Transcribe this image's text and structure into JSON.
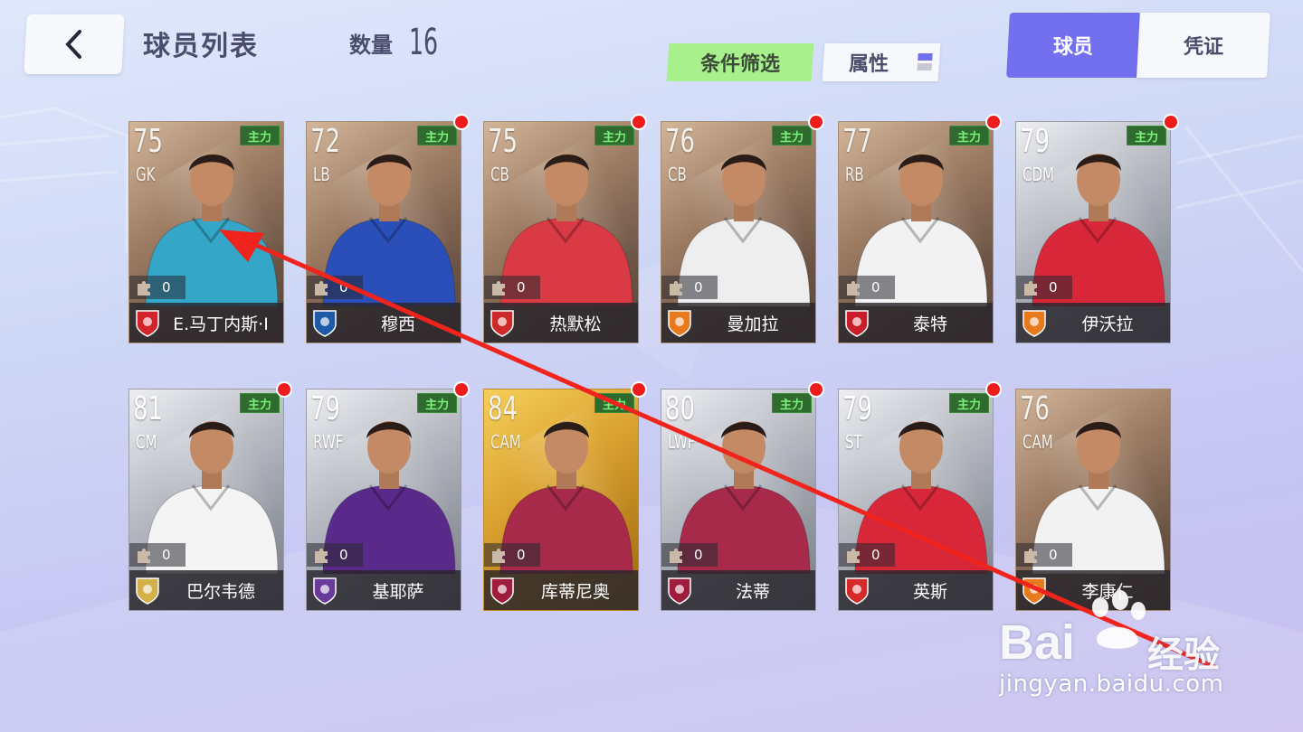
{
  "header": {
    "title": "球员列表",
    "count_label": "数量",
    "count_value": "16",
    "filter_label": "条件筛选",
    "attribute_label": "属性",
    "tabs": [
      {
        "label": "球员",
        "active": true
      },
      {
        "label": "凭证",
        "active": false
      }
    ]
  },
  "colors": {
    "accent": "#7370ef",
    "filter_bg": "#a8f08c",
    "badge_red": "#ee1c1c",
    "tag_green": "#2f6a2f",
    "annotation_arrow": "#f0241c"
  },
  "cards": [
    {
      "rating": "75",
      "position": "GK",
      "tag": "主力",
      "name": "E.马丁内斯·I",
      "fragments": "0",
      "tier": "bronze",
      "jersey": "#34a6c8",
      "club": "#d3232b",
      "new": false
    },
    {
      "rating": "72",
      "position": "LB",
      "tag": "主力",
      "name": "穆西",
      "fragments": "0",
      "tier": "bronze",
      "jersey": "#2a4fb8",
      "club": "#1e5aa8",
      "new": true
    },
    {
      "rating": "75",
      "position": "CB",
      "tag": "主力",
      "name": "热默松",
      "fragments": "0",
      "tier": "bronze",
      "jersey": "#d93a44",
      "club": "#cf2a2a",
      "new": true
    },
    {
      "rating": "76",
      "position": "CB",
      "tag": "主力",
      "name": "曼加拉",
      "fragments": "0",
      "tier": "bronze",
      "jersey": "#eeeeee",
      "club": "#e87a1e",
      "new": true
    },
    {
      "rating": "77",
      "position": "RB",
      "tag": "主力",
      "name": "泰特",
      "fragments": "0",
      "tier": "bronze",
      "jersey": "#f2f2f2",
      "club": "#c81e2a",
      "new": true
    },
    {
      "rating": "79",
      "position": "CDM",
      "tag": "主力",
      "name": "伊沃拉",
      "fragments": "0",
      "tier": "silver",
      "jersey": "#d9273a",
      "club": "#e87a1e",
      "new": true
    },
    {
      "rating": "81",
      "position": "CM",
      "tag": "主力",
      "name": "巴尔韦德",
      "fragments": "0",
      "tier": "silver",
      "jersey": "#f4f4f4",
      "club": "#d4b04a",
      "new": true
    },
    {
      "rating": "79",
      "position": "RWF",
      "tag": "主力",
      "name": "基耶萨",
      "fragments": "0",
      "tier": "silver",
      "jersey": "#5a2a8a",
      "club": "#6a3a9a",
      "new": true
    },
    {
      "rating": "84",
      "position": "CAM",
      "tag": "主力",
      "name": "库蒂尼奥",
      "fragments": "0",
      "tier": "gold",
      "jersey": "#a72a4a",
      "club": "#a01c3c",
      "new": true
    },
    {
      "rating": "80",
      "position": "LWF",
      "tag": "主力",
      "name": "法蒂",
      "fragments": "0",
      "tier": "silver",
      "jersey": "#a72a4a",
      "club": "#a01c3c",
      "new": true
    },
    {
      "rating": "79",
      "position": "ST",
      "tag": "主力",
      "name": "英斯",
      "fragments": "0",
      "tier": "silver",
      "jersey": "#d9273a",
      "club": "#d62a2a",
      "new": true
    },
    {
      "rating": "76",
      "position": "CAM",
      "tag": "",
      "name": "李康仁",
      "fragments": "0",
      "tier": "bronze",
      "jersey": "#f2f2f2",
      "club": "#e87a1e",
      "new": false
    }
  ],
  "watermark": {
    "brand": "Bai",
    "brand_cn": "经验",
    "domain": "jingyan.baidu.com"
  }
}
